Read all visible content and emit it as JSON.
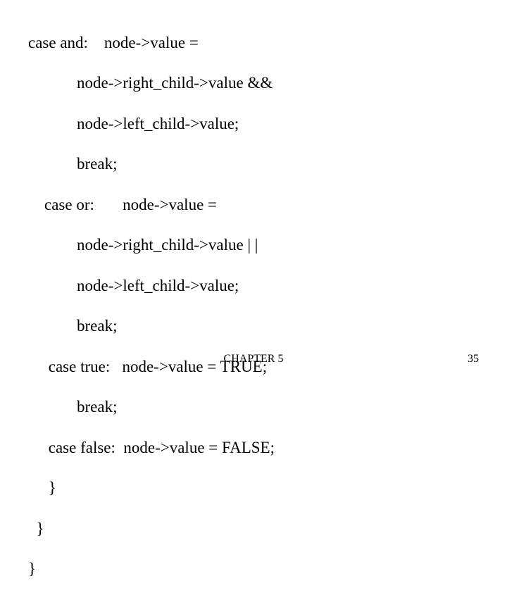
{
  "code": {
    "l01": "case and:    node->value =",
    "l02": "            node->right_child->value &&",
    "l03": "            node->left_child->value;",
    "l04": "            break;",
    "l05": "    case or:       node->value =",
    "l06": "            node->right_child->value | |",
    "l07": "            node->left_child->value;",
    "l08": "            break;",
    "l09": "     case true:   node->value = TRUE;",
    "l10": "            break;",
    "l11": "     case false:  node->value = FALSE;",
    "l12": "     }",
    "l13": "  }",
    "l14": "}"
  },
  "footer": {
    "center": "CHAPTER 5",
    "right": "35"
  }
}
